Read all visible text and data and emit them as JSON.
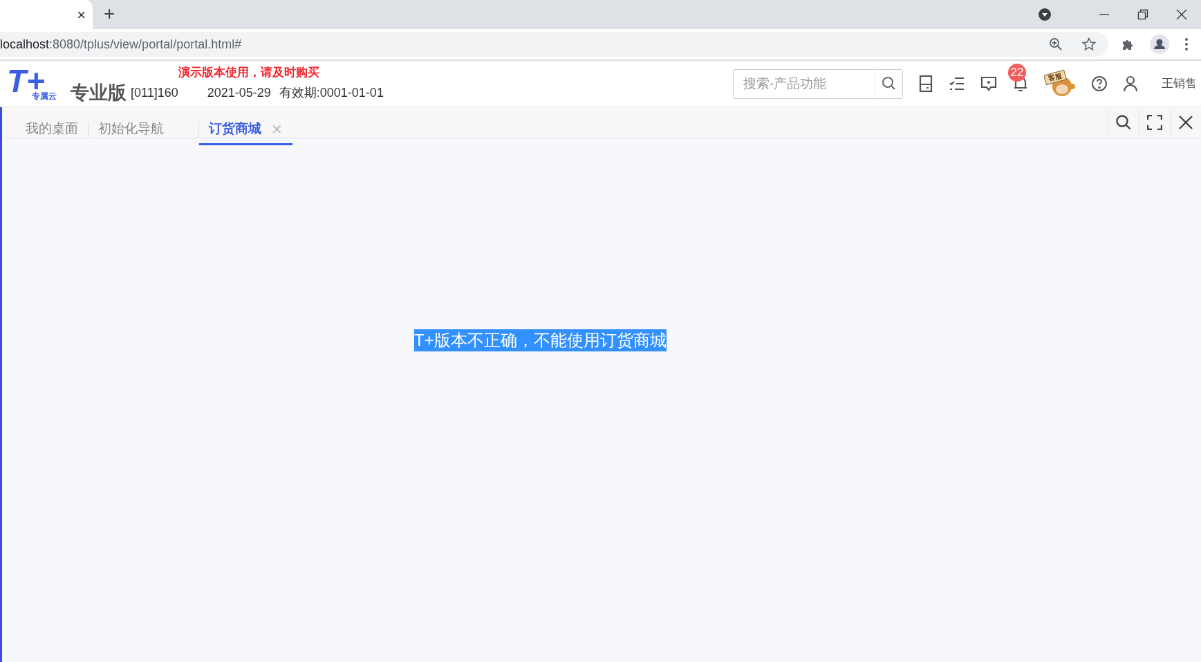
{
  "browser": {
    "tab_close": "×",
    "new_tab": "+",
    "url_host": "localhost",
    "url_rest": ":8080/tplus/view/portal/portal.html#"
  },
  "header": {
    "logo_mark": "T+",
    "logo_sub": "专属云",
    "edition": "专业版",
    "notice": "演示版本使用，请及时购买",
    "account": "[011]160",
    "date": "2021-05-29",
    "validity": "有效期:0001-01-01",
    "search": {
      "placeholder": "搜索-产品功能"
    },
    "notification_count": "22",
    "mascot_sign": "客服",
    "user": "王销售"
  },
  "tabs": [
    {
      "label": "我的桌面",
      "selected": false,
      "closable": false
    },
    {
      "label": "初始化导航",
      "selected": false,
      "closable": false
    },
    {
      "label": "订货商城",
      "selected": true,
      "closable": true
    }
  ],
  "close_glyph": "✕",
  "message": "T+版本不正确，不能使用订货商城"
}
